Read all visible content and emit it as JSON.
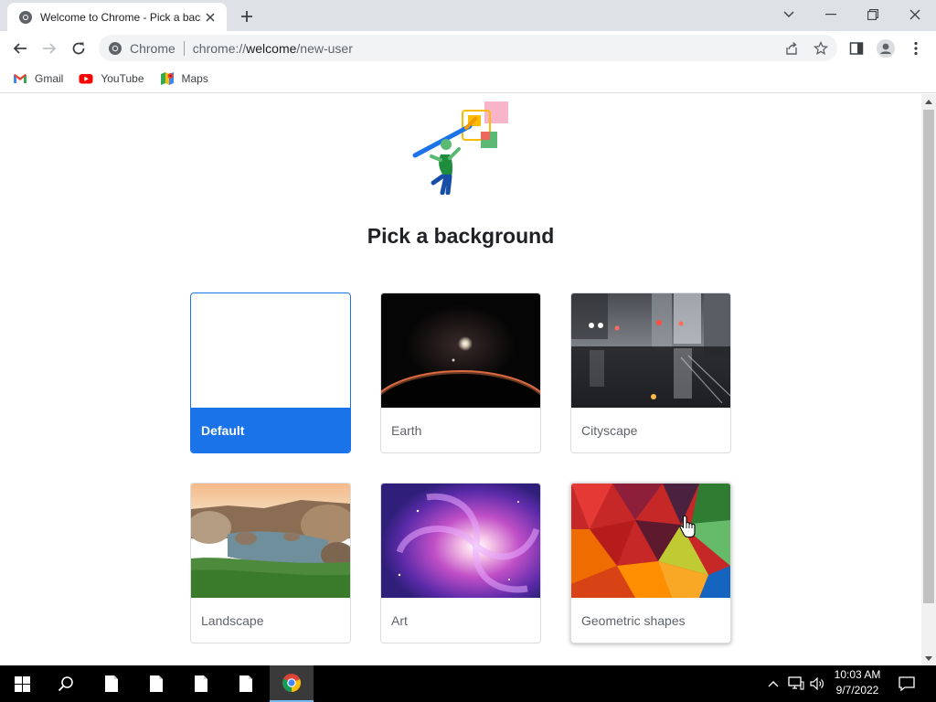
{
  "tab": {
    "title": "Welcome to Chrome - Pick a background"
  },
  "omnibox": {
    "chip": "Chrome",
    "url_scheme": "chrome://",
    "url_host": "welcome",
    "url_path": "/new-user"
  },
  "bookmarks": [
    {
      "label": "Gmail",
      "icon": "gmail-icon"
    },
    {
      "label": "YouTube",
      "icon": "youtube-icon"
    },
    {
      "label": "Maps",
      "icon": "maps-icon"
    }
  ],
  "page": {
    "heading": "Pick a background",
    "backgrounds": [
      {
        "label": "Default",
        "selected": true
      },
      {
        "label": "Earth",
        "selected": false
      },
      {
        "label": "Cityscape",
        "selected": false
      },
      {
        "label": "Landscape",
        "selected": false
      },
      {
        "label": "Art",
        "selected": false
      },
      {
        "label": "Geometric shapes",
        "selected": false
      }
    ]
  },
  "taskbar": {
    "time": "10:03 AM",
    "date": "9/7/2022"
  },
  "colors": {
    "accent": "#1a73e8",
    "tabstrip": "#dee1e6",
    "taskbar": "#000000"
  }
}
